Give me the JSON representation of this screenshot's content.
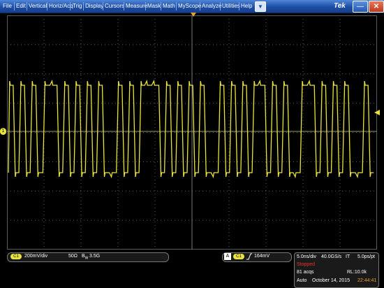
{
  "menu": {
    "items": [
      "File",
      "Edit",
      "Vertical",
      "Horiz/Acq",
      "Trig",
      "Display",
      "Cursors",
      "Measure",
      "Mask",
      "Math",
      "MyScope",
      "Analyze",
      "Utilities",
      "Help"
    ],
    "dropdown_icon": "triangle-down-icon",
    "logo": "Tek",
    "minimize_icon": "minimize-icon",
    "close_icon": "close-icon"
  },
  "colors": {
    "trace": "#e8e43b",
    "grid": "#5a5a5a",
    "menubar": "#1c4ea6",
    "stopped": "#e8322a",
    "timestamp": "#e8a030"
  },
  "ch1_marker": "1",
  "channel": {
    "badge": "C1",
    "scale": "200mV/div",
    "impedance": "50Ω",
    "bandwidth_symbol": "B",
    "bandwidth_sub": "W",
    "bandwidth": "3.5G"
  },
  "trigger": {
    "mode_icon": "A",
    "badge": "C1",
    "slope_icon": "rising-edge-icon",
    "level": "164mV"
  },
  "acquisition": {
    "timebase": "5.0ns/div",
    "sample_rate": "40.0GS/s",
    "mode": "IT",
    "resolution": "5.0ps/pt",
    "state": "Stopped",
    "acqs": "81 acqs",
    "record_length": "RL:10.0k",
    "trigger_mode": "Auto",
    "date": "October 14, 2015",
    "time": "22:44:41"
  }
}
